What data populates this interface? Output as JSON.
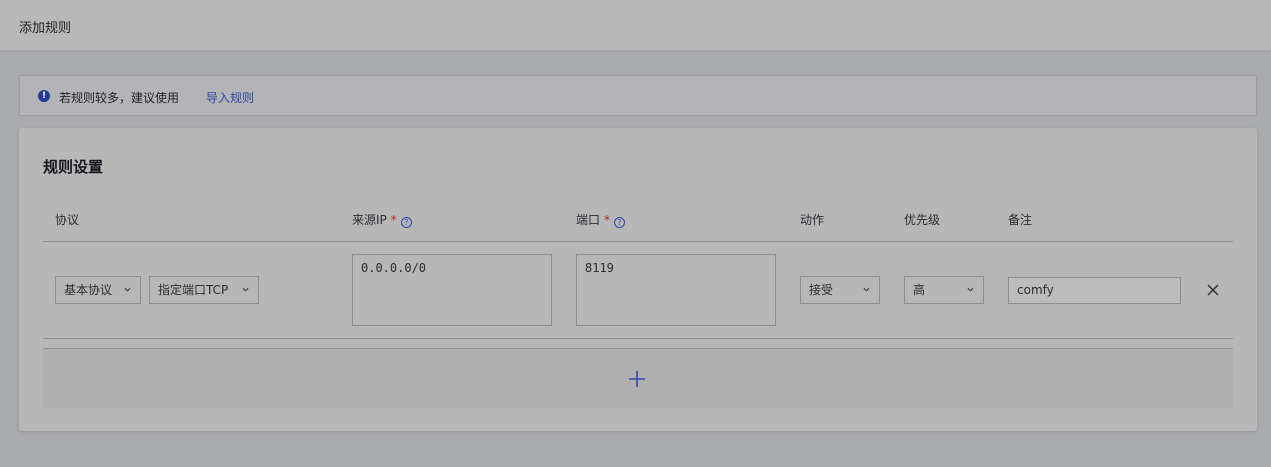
{
  "header": {
    "title": "添加规则"
  },
  "notice": {
    "text": "若规则较多，建议使用",
    "link": "导入规则",
    "icon": "info-icon"
  },
  "card": {
    "title": "规则设置",
    "columns": {
      "protocol": "协议",
      "source_ip": "来源IP",
      "port": "端口",
      "action": "动作",
      "priority": "优先级",
      "remark": "备注"
    },
    "required_mark": "*",
    "row": {
      "protocol_type": "基本协议",
      "protocol_detail": "指定端口TCP",
      "source_ip": "0.0.0.0/0",
      "port": "8119",
      "action": "接受",
      "priority": "高",
      "remark": "comfy"
    }
  },
  "colors": {
    "accent": "#2f47a8",
    "required": "#b3262a"
  }
}
